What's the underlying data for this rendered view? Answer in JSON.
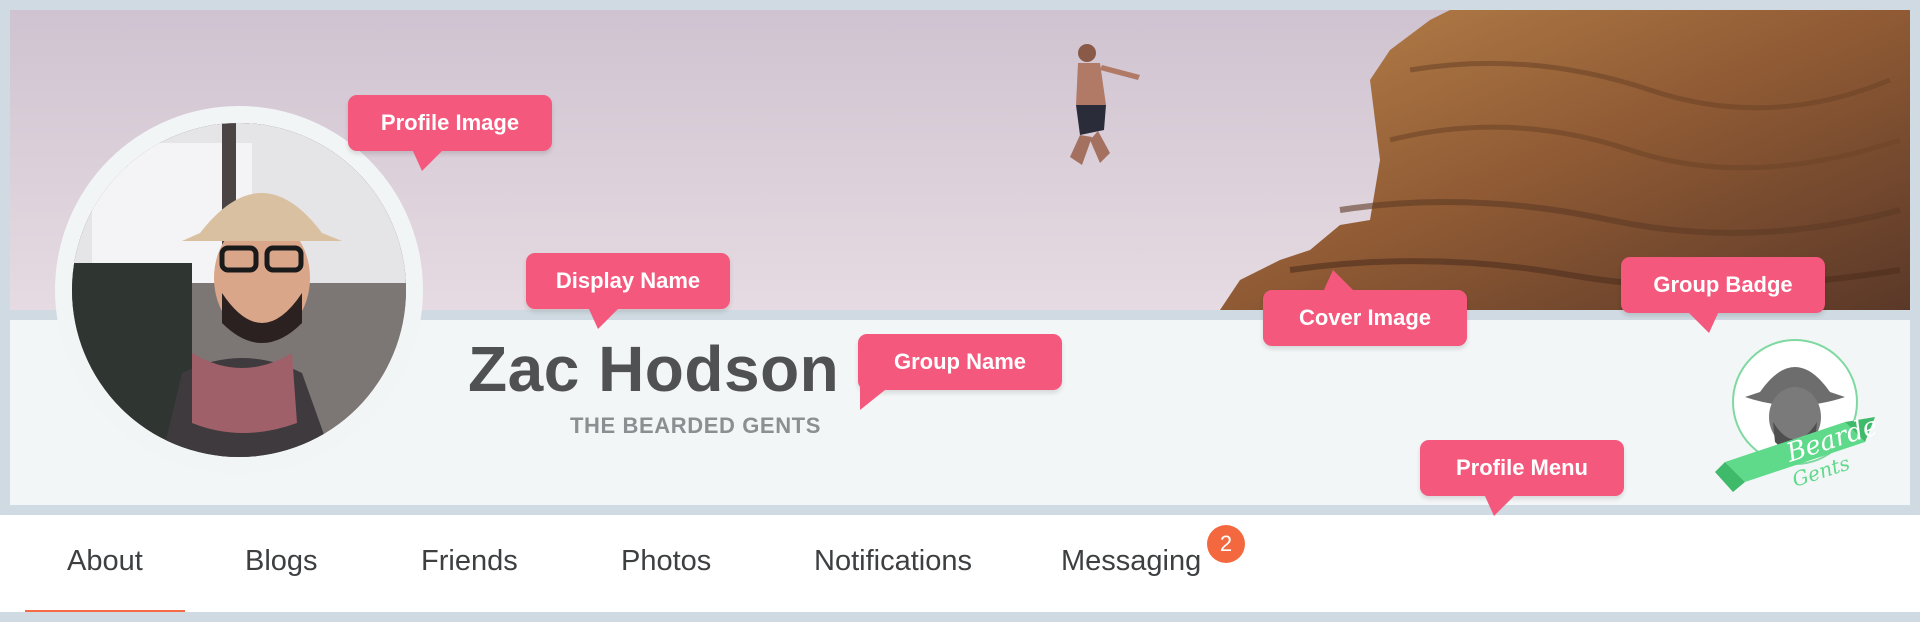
{
  "profile": {
    "display_name": "Zac Hodson",
    "group_name": "THE BEARDED GENTS",
    "badge_text_1": "Bearded",
    "badge_text_2": "Gents"
  },
  "nav": {
    "items": [
      {
        "label": "About",
        "active": true
      },
      {
        "label": "Blogs",
        "active": false
      },
      {
        "label": "Friends",
        "active": false
      },
      {
        "label": "Photos",
        "active": false
      },
      {
        "label": "Notifications",
        "active": false
      },
      {
        "label": "Messaging",
        "active": false,
        "badge": "2"
      }
    ]
  },
  "callouts": {
    "profile_image": "Profile Image",
    "display_name": "Display Name",
    "group_name": "Group Name",
    "cover_image": "Cover Image",
    "group_badge": "Group Badge",
    "profile_menu": "Profile Menu"
  },
  "colors": {
    "callout": "#f4587d",
    "accent": "#f46b45",
    "badge_green": "#5fd98a"
  }
}
